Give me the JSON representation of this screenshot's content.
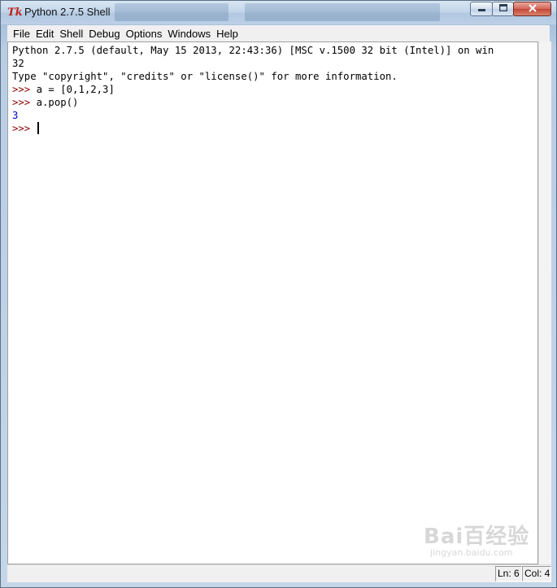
{
  "window": {
    "title": "Python 2.7.5 Shell",
    "app_icon": "tk-feather-icon",
    "controls": {
      "minimize": "minimize-icon",
      "maximize": "maximize-icon",
      "close": "close-icon"
    }
  },
  "menu": [
    "File",
    "Edit",
    "Shell",
    "Debug",
    "Options",
    "Windows",
    "Help"
  ],
  "shell": {
    "lines": [
      {
        "text": "Python 2.7.5 (default, May 15 2013, 22:43:36) [MSC v.1500 32 bit (Intel)] on win"
      },
      {
        "text": "32"
      },
      {
        "text": "Type \"copyright\", \"credits\" or \"license()\" for more information."
      },
      {
        "prompt": ">>> ",
        "text": "a = [0,1,2,3]"
      },
      {
        "prompt": ">>> ",
        "text": "a.pop()"
      },
      {
        "text": "3",
        "style": "output"
      },
      {
        "prompt": ">>> ",
        "text": ""
      }
    ]
  },
  "status": {
    "line": "Ln: 6",
    "col": "Col: 4"
  },
  "watermark": {
    "main": "Bai百经验",
    "sub": "jingyan.baidu.com"
  },
  "colors": {
    "prompt": "#8b0000",
    "output": "#0000c8",
    "titlebar": "#bcd0e6"
  }
}
